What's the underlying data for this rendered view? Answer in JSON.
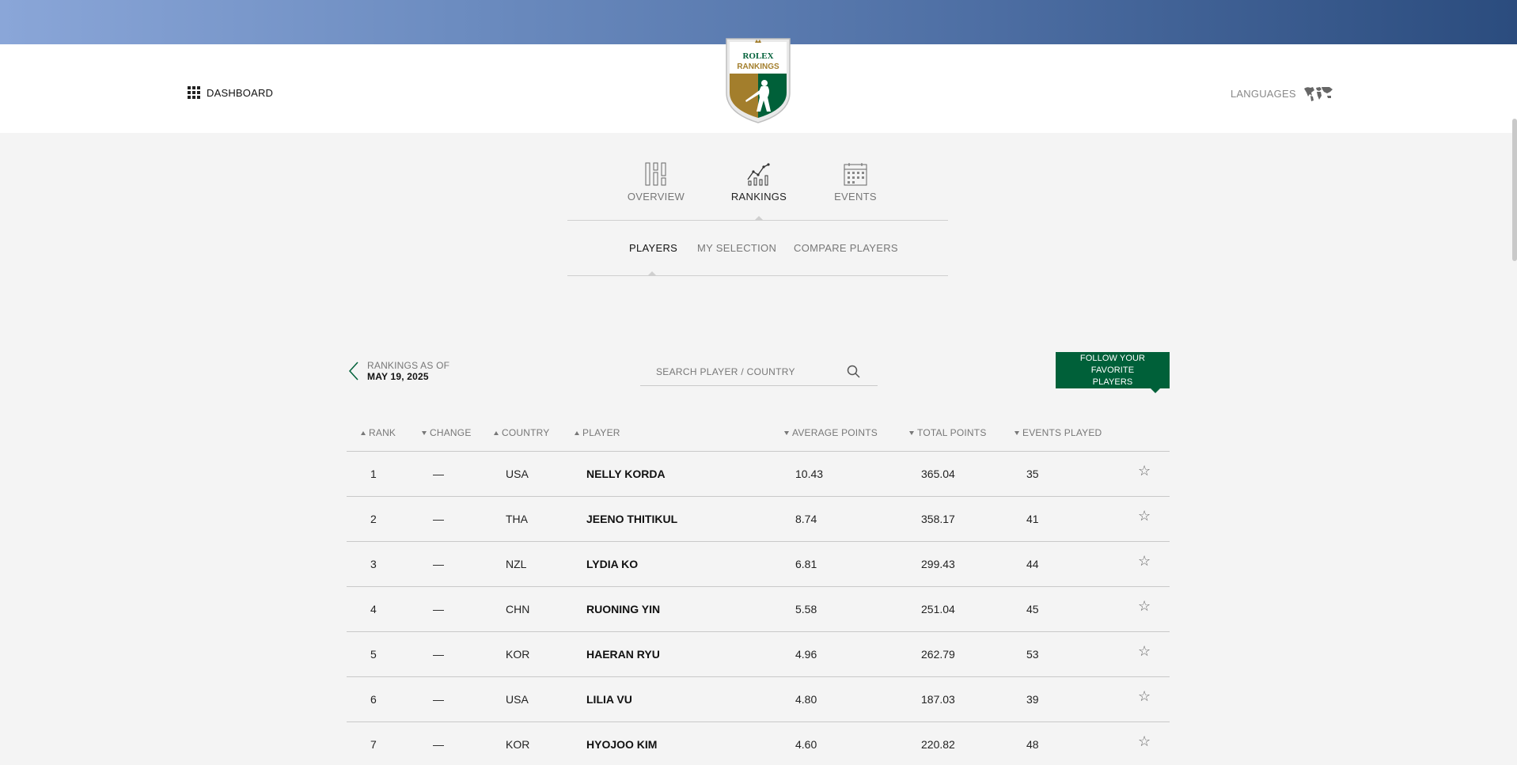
{
  "header": {
    "dashboard_label": "DASHBOARD",
    "logo": {
      "line1": "ROLEX",
      "line2": "RANKINGS"
    },
    "languages_label": "LANGUAGES"
  },
  "main_nav": {
    "tabs": [
      {
        "label": "OVERVIEW",
        "icon": "overview-bars-icon",
        "active": false
      },
      {
        "label": "RANKINGS",
        "icon": "rankings-chart-icon",
        "active": true
      },
      {
        "label": "EVENTS",
        "icon": "events-calendar-icon",
        "active": false
      }
    ]
  },
  "sub_nav": {
    "tabs": [
      {
        "label": "PLAYERS",
        "active": true
      },
      {
        "label": "MY SELECTION",
        "active": false
      },
      {
        "label": "COMPARE PLAYERS",
        "active": false
      }
    ]
  },
  "rankings_date": {
    "label": "RANKINGS AS OF",
    "date": "MAY 19, 2025"
  },
  "search": {
    "placeholder": "SEARCH PLAYER / COUNTRY",
    "value": ""
  },
  "follow_button": {
    "label": "FOLLOW YOUR FAVORITE PLAYERS"
  },
  "table": {
    "columns": [
      {
        "label": "RANK",
        "sort": "up"
      },
      {
        "label": "CHANGE",
        "sort": "down"
      },
      {
        "label": "COUNTRY",
        "sort": "up"
      },
      {
        "label": "PLAYER",
        "sort": "up"
      },
      {
        "label": "AVERAGE POINTS",
        "sort": "down"
      },
      {
        "label": "TOTAL POINTS",
        "sort": "down"
      },
      {
        "label": "EVENTS PLAYED",
        "sort": "down"
      }
    ],
    "rows": [
      {
        "rank": "1",
        "change": "—",
        "country": "USA",
        "player": "NELLY KORDA",
        "avg": "10.43",
        "total": "365.04",
        "events": "35"
      },
      {
        "rank": "2",
        "change": "—",
        "country": "THA",
        "player": "JEENO THITIKUL",
        "avg": "8.74",
        "total": "358.17",
        "events": "41"
      },
      {
        "rank": "3",
        "change": "—",
        "country": "NZL",
        "player": "LYDIA KO",
        "avg": "6.81",
        "total": "299.43",
        "events": "44"
      },
      {
        "rank": "4",
        "change": "—",
        "country": "CHN",
        "player": "RUONING YIN",
        "avg": "5.58",
        "total": "251.04",
        "events": "45"
      },
      {
        "rank": "5",
        "change": "—",
        "country": "KOR",
        "player": "HAERAN RYU",
        "avg": "4.96",
        "total": "262.79",
        "events": "53"
      },
      {
        "rank": "6",
        "change": "—",
        "country": "USA",
        "player": "LILIA VU",
        "avg": "4.80",
        "total": "187.03",
        "events": "39"
      },
      {
        "rank": "7",
        "change": "—",
        "country": "KOR",
        "player": "HYOJOO KIM",
        "avg": "4.60",
        "total": "220.82",
        "events": "48"
      }
    ]
  },
  "colors": {
    "brand_green": "#006039",
    "brand_gold": "#a37e2c",
    "banner_dark": "#2b4c7e",
    "banner_light": "#8aa6d8"
  }
}
